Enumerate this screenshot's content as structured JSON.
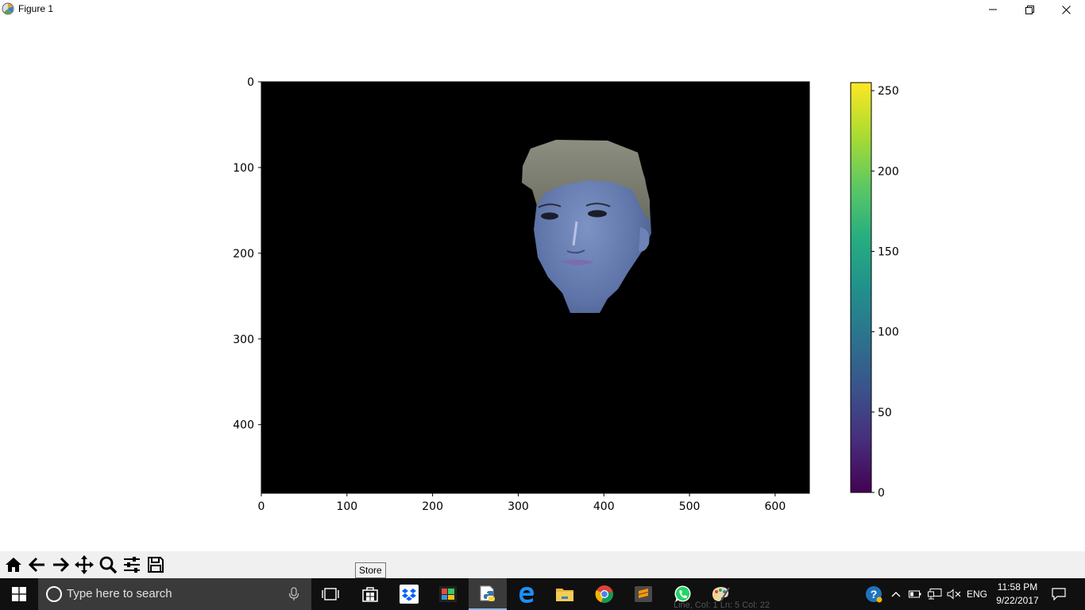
{
  "window": {
    "title": "Figure 1",
    "controls": [
      "minimize",
      "restore",
      "close"
    ]
  },
  "chart_data": {
    "type": "heatmap",
    "title": "",
    "xlabel": "",
    "ylabel": "",
    "x_ticks": [
      0,
      100,
      200,
      300,
      400,
      500,
      600
    ],
    "y_ticks": [
      0,
      100,
      200,
      300,
      400
    ],
    "xlim": [
      0,
      640
    ],
    "ylim": [
      480,
      0
    ],
    "image_content": "masked face on black background",
    "colorbar": {
      "colormap": "viridis",
      "ticks": [
        0,
        50,
        100,
        150,
        200,
        250
      ],
      "range": [
        0,
        255
      ]
    }
  },
  "toolbar": {
    "buttons": [
      "home-icon",
      "back-icon",
      "forward-icon",
      "pan-icon",
      "zoom-icon",
      "configure-subplots-icon",
      "save-icon"
    ],
    "tooltip": "Store"
  },
  "taskbar": {
    "search_placeholder": "Type here to search",
    "apps": [
      "task-view-icon",
      "store-icon",
      "dropbox-icon",
      "photos-icon",
      "python-icon",
      "edge-icon",
      "file-explorer-icon",
      "chrome-icon",
      "sublime-text-icon",
      "whatsapp-icon",
      "paint-icon"
    ],
    "active_app": "python-icon",
    "tray": {
      "language": "ENG",
      "time": "11:58 PM",
      "date": "9/22/2017"
    },
    "ghost_status": "Line, Col: 1  Ln: 5   Col: 22"
  },
  "colors": {
    "taskbar_bg": "#101010",
    "search_bg": "#3a3a3a",
    "toolbar_bg": "#f0f0f0",
    "active_indicator": "#8eb4e6"
  }
}
